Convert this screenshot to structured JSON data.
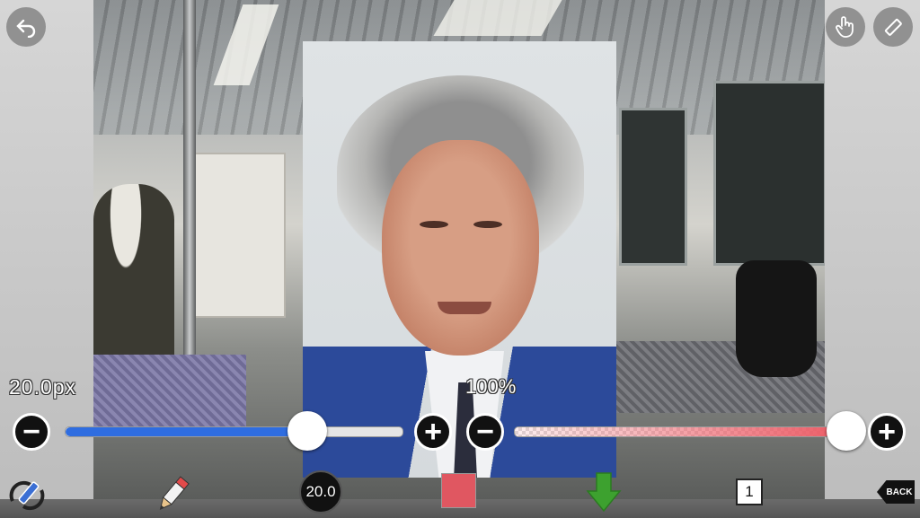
{
  "brush_size": {
    "label": "20.0px",
    "fraction": 0.72
  },
  "opacity": {
    "label": "100%",
    "fraction": 1.0
  },
  "toolbar": {
    "brush_value": "20.0",
    "layer_number": "1",
    "back_label": "BACK",
    "color": "#e05761"
  },
  "slider_colors": {
    "size_fill": "#2f6de0",
    "opacity_fill": "#ec5a64"
  },
  "icons": {
    "undo": "undo-icon",
    "hand": "hand-touch-icon",
    "eraser": "eraser-icon",
    "swap": "swap-tools-icon",
    "pencil": "pencil-icon",
    "save": "down-arrow-icon",
    "layer": "layer-icon",
    "minus": "minus-icon",
    "plus": "plus-icon"
  },
  "glyphs": {
    "minus": "−",
    "plus": "+"
  }
}
